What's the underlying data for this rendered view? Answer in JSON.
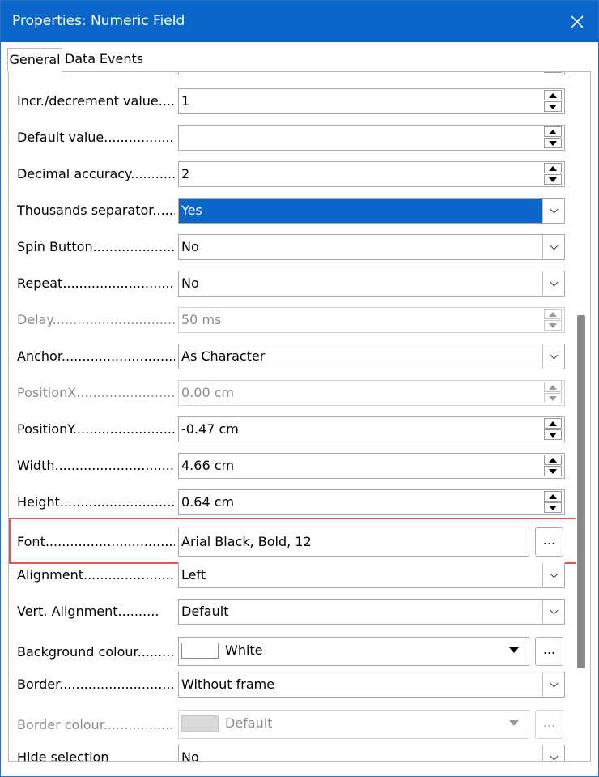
{
  "window": {
    "title": "Properties: Numeric Field"
  },
  "tabs": [
    {
      "label": "General"
    },
    {
      "label": "Data"
    },
    {
      "label": "Events"
    }
  ],
  "rows": {
    "incr": {
      "label": "Incr./decrement value",
      "value": "1"
    },
    "default": {
      "label": "Default value",
      "value": ""
    },
    "decimal": {
      "label": "Decimal accuracy",
      "value": "2"
    },
    "thousands": {
      "label": "Thousands separator",
      "value": "Yes"
    },
    "spin": {
      "label": "Spin Button",
      "value": "No"
    },
    "repeat": {
      "label": "Repeat",
      "value": "No"
    },
    "delay": {
      "label": "Delay",
      "value": "50 ms"
    },
    "anchor": {
      "label": "Anchor",
      "value": "As Character"
    },
    "posx": {
      "label": "PositionX",
      "value": "0.00 cm"
    },
    "posy": {
      "label": "PositionY",
      "value": "-0.47 cm"
    },
    "width": {
      "label": "Width",
      "value": "4.66 cm"
    },
    "height": {
      "label": "Height",
      "value": "0.64 cm"
    },
    "font": {
      "label": "Font",
      "value": "Arial Black, Bold, 12",
      "button": "..."
    },
    "alignment": {
      "label": "Alignment",
      "value": "Left"
    },
    "valign": {
      "label": "Vert. Alignment",
      "value": "Default"
    },
    "bgcolor": {
      "label": "Background colour",
      "value": "White",
      "button": "..."
    },
    "border": {
      "label": "Border",
      "value": "Without frame"
    },
    "bordercolor": {
      "label": "Border colour",
      "value": "Default",
      "button": "..."
    },
    "hidesel": {
      "label": "Hide selection",
      "value": "No"
    }
  },
  "colors": {
    "titlebar": "#0a66c9",
    "selection": "#0a66c9",
    "highlight": "#e35555"
  }
}
